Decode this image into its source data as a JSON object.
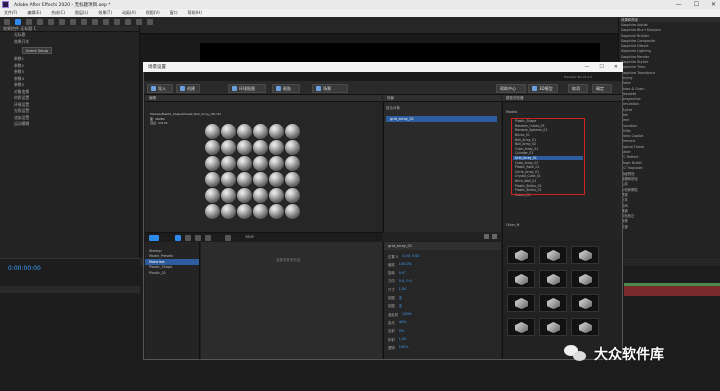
{
  "window": {
    "title": "Adobe After Effects 2020 - 无标题项目.aep *"
  },
  "menubar": {
    "items": [
      "文件(F)",
      "编辑(E)",
      "合成(C)",
      "图层(L)",
      "效果(T)",
      "动画(A)",
      "视图(V)",
      "窗口",
      "帮助(H)"
    ]
  },
  "left_panel": {
    "tab": "效果控件 无标题 1",
    "items": [
      "无标题",
      "效果开关",
      "参数1",
      "参数2",
      "参数3",
      "参数4",
      "参数5",
      "对象变换",
      "材质设置",
      "环境设置",
      "光照设置",
      "渲染设置",
      "运动模糊"
    ],
    "button": "Scene Setup"
  },
  "right_panel": {
    "tab": "效果和预设",
    "items": [
      "Sapphire Adjust",
      "Sapphire Blur+Sharpen",
      "Sapphire Builder",
      "Sapphire Composite",
      "Sapphire Distort",
      "Sapphire Lighting",
      "Sapphire Render",
      "Sapphire Stylize",
      "Sapphire Time",
      "Sapphire Transitions",
      "Keying",
      "Matte",
      "Noise & Grain",
      "Obsolete",
      "Perspective",
      "Simulation",
      "Stylize",
      "Text",
      "Time",
      "Transition",
      "Utility",
      "Video Copilot",
      "Element",
      "Optical Flares",
      "Saber",
      "VC Reflect",
      "Magic Bullet",
      "RG Trapcode",
      "动画预设",
      "模糊和锐化",
      "生成",
      "杂色和颗粒",
      "透视",
      "文本",
      "时间",
      "通道",
      "颜色校正",
      "音频",
      "过渡"
    ]
  },
  "timeline": {
    "timecode": "0:00:00:00"
  },
  "dialog": {
    "title": "场景设置",
    "top_strip": "Element 3D v2.2.2",
    "controls": {
      "minimize": "—",
      "maximize": "☐",
      "close": "✕"
    },
    "toolbar": {
      "import": "导入",
      "create": "创建",
      "env": "环境贴图",
      "paste": "粘贴",
      "scene": "场景",
      "help": "帮助中心",
      "preset": "3D模型",
      "cancel": "取消",
      "ok": "确定"
    },
    "viewport": {
      "header": "编辑",
      "info_lines": [
        "Models/Plastic_Shape/Preset_Ball_Array_08.c4d",
        "面: 46080",
        "顶点: 23124"
      ],
      "layout_label": "360P"
    },
    "project": {
      "header": "场景",
      "group": "组合对象",
      "selected": "grid_array_01"
    },
    "tree": {
      "header": "模型浏览器",
      "root": "Models",
      "items": [
        "Plastic_Shape",
        "Random_Cubes_03",
        "Random_Spheres_01",
        "Bricks_01",
        "Ball_Array_01",
        "Ball_Array_02",
        "Cube_Array_01",
        "Cylinder_01",
        "Grid_Array_01",
        "Cube_Array_02",
        "Plastic_Rock_01",
        "Circle_Array_01",
        "Crystal_Cube_01",
        "Brick_Wall_01",
        "Plastic_Bricks_03",
        "Plastic_Bricks_01",
        "Cables_01"
      ],
      "selected_index": 8,
      "lower_group": "Other_M"
    },
    "browser_left": {
      "items": [
        "Startup",
        "Model_Presets",
        "Materials",
        "Plastic_Shape",
        "Plastic_01"
      ],
      "selected_index": 2
    },
    "browser_mid": {
      "text": "当前文件夹为空"
    },
    "props": {
      "header": "grid_array_01",
      "rows": [
        {
          "label": "位置 X",
          "value": "0.00, 0.00"
        },
        {
          "label": "缩放",
          "value": "100.0%"
        },
        {
          "label": "旋转",
          "value": "0.0°"
        },
        {
          "label": "方向",
          "value": "0.0, 0.0"
        },
        {
          "label": "尺寸",
          "value": "1.00"
        },
        {
          "label": "贴图",
          "value": "无"
        },
        {
          "label": "贴图",
          "value": "无"
        },
        {
          "label": "漫反射",
          "value": "100%"
        },
        {
          "label": "高光",
          "value": "40%"
        },
        {
          "label": "反射",
          "value": "0%"
        },
        {
          "label": "折射",
          "value": "1.00"
        },
        {
          "label": "透明",
          "value": "100%"
        }
      ]
    }
  },
  "watermark": {
    "text": "大众软件库"
  },
  "colors": {
    "accent": "#2d8ceb",
    "selection": "#2d5d9e",
    "highlight_box": "#d02020"
  }
}
